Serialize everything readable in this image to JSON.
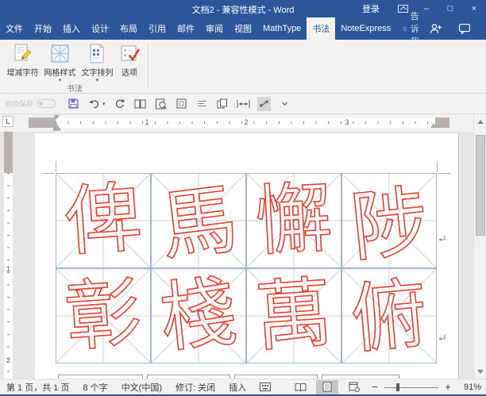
{
  "titlebar": {
    "title": "文档2 - 兼容性模式 - Word",
    "signin": "登录"
  },
  "tabs": {
    "items": [
      "文件",
      "开始",
      "插入",
      "设计",
      "布局",
      "引用",
      "邮件",
      "审阅",
      "视图",
      "MathType",
      "书法",
      "NoteExpress"
    ],
    "active": "书法",
    "tellme": "告诉我"
  },
  "ribbon": {
    "group_label": "书法",
    "buttons": [
      {
        "label": "增减字符"
      },
      {
        "label": "网格样式"
      },
      {
        "label": "文字排列"
      },
      {
        "label": "选项"
      }
    ]
  },
  "qat": {
    "autosave_label": "自动保存"
  },
  "ruler": {
    "horizontal_numbers": [
      "1",
      "2",
      "3"
    ],
    "vertical_numbers": [
      "1",
      "2"
    ]
  },
  "document": {
    "characters": [
      "俾",
      "馬",
      "懈",
      "陟",
      "彰",
      "棧",
      "萬",
      "俯"
    ],
    "grid": {
      "rows": 2,
      "cols": 4,
      "style": "米字格"
    },
    "char_color": "#e5402f",
    "grid_line_color": "#9fb6d9",
    "grid_inner_line_color": "#c7d6eb"
  },
  "statusbar": {
    "page_info": "第 1 页，共 1 页",
    "word_count": "8 个字",
    "language": "中文(中国)",
    "track_changes": "修订: 关闭",
    "insert_mode": "插入",
    "zoom_level": "91%"
  },
  "colors": {
    "accent": "#2b579a",
    "ribbon_bg": "#f3f2f1",
    "doc_bg": "#e7e6e5"
  }
}
